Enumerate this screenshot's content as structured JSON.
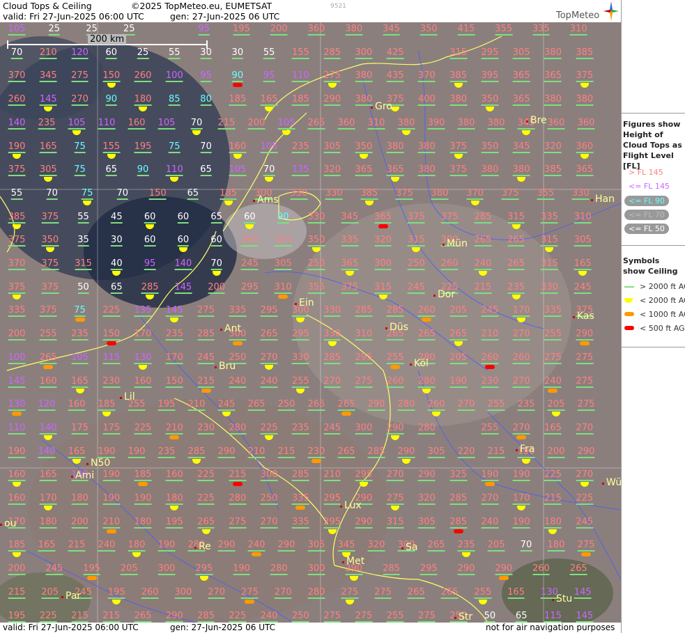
{
  "header": {
    "title": "Cloud Tops & Ceiling",
    "copyright": "©2025 TopMeteo.eu, EUMETSAT",
    "valid": "valid:  Fri  27-Jun-2025  06:00 UTC",
    "gen": "gen: 27-Jun-2025 06 UTC",
    "code": "9521",
    "logo": "TopMeteo"
  },
  "footer": {
    "valid": "valid:  Fri  27-Jun-2025  06:00 UTC",
    "gen": "gen: 27-Jun-2025 06 UTC",
    "disclaimer": "not for air navigation purposes"
  },
  "scale": {
    "label": "200 km"
  },
  "sidebar": {
    "figures_title": "Figures show Height of Cloud Tops as Flight Level  [FL]",
    "fl_legend": [
      "> FL 145",
      "<= FL 145",
      "<= FL 90",
      "<= FL 70",
      "<= FL 50"
    ],
    "symbols_title": "Symbols show Ceiling",
    "ceiling_legend": [
      "> 2000 ft AGL",
      "< 2000 ft AGL",
      "< 1000 ft AGL",
      "< 500 ft AGL"
    ],
    "colors": {
      "pink": "#ff8080",
      "violet": "#cc66ff",
      "cyan": "#66ffff",
      "grey": "#bbbbbb",
      "white": "#ffffff",
      "green": "#7ee07e",
      "yellow": "#ffff00",
      "orange": "#ff9900",
      "red": "#ff0000"
    }
  },
  "cities": [
    "Gro",
    "Bre",
    "Ams",
    "Han",
    "Mün",
    "Ein",
    "Dor",
    "Ant",
    "Düs",
    "Kas",
    "Bru",
    "Köl",
    "Lil",
    "Fra",
    "N50",
    "Ami",
    "Wü",
    "Lux",
    "Sa",
    "Re",
    "Met",
    "Par",
    "Stu",
    "Str",
    "ou"
  ],
  "grid_rows": [
    [
      "105",
      "25",
      "25",
      "25",
      "",
      "95",
      "195",
      "200",
      "360",
      "380",
      "345",
      "350",
      "415",
      "355",
      "335",
      "310"
    ],
    [
      "70",
      "210",
      "120",
      "60",
      "25",
      "55",
      "30",
      "30",
      "55",
      "155",
      "285",
      "300",
      "425",
      "",
      "315",
      "295",
      "305",
      "380",
      "385"
    ],
    [
      "370",
      "345",
      "275",
      "150",
      "260",
      "100",
      "95",
      "90",
      "95",
      "110",
      "275",
      "380",
      "435",
      "370",
      "385",
      "395",
      "365",
      "365",
      "375"
    ],
    [
      "260",
      "145",
      "270",
      "90",
      "180",
      "85",
      "80",
      "185",
      "165",
      "185",
      "290",
      "380",
      "375",
      "400",
      "380",
      "350",
      "365",
      "380",
      "380"
    ],
    [
      "140",
      "235",
      "105",
      "110",
      "160",
      "105",
      "70",
      "215",
      "200",
      "105",
      "265",
      "360",
      "310",
      "380",
      "390",
      "380",
      "380",
      "345",
      "360",
      "360"
    ],
    [
      "190",
      "165",
      "75",
      "155",
      "195",
      "75",
      "70",
      "160",
      "105",
      "235",
      "305",
      "350",
      "380",
      "380",
      "375",
      "350",
      "345",
      "320",
      "360"
    ],
    [
      "375",
      "305",
      "75",
      "65",
      "90",
      "110",
      "65",
      "105",
      "70",
      "135",
      "320",
      "365",
      "365",
      "380",
      "375",
      "380",
      "380",
      "385",
      "365"
    ],
    [
      "55",
      "70",
      "75",
      "70",
      "150",
      "65",
      "185",
      "300",
      "330",
      "330",
      "385",
      "375",
      "380",
      "370",
      "375",
      "355",
      "330"
    ],
    [
      "385",
      "375",
      "55",
      "45",
      "60",
      "60",
      "65",
      "60",
      "90",
      "330",
      "345",
      "365",
      "375",
      "375",
      "285",
      "315",
      "335",
      "310"
    ],
    [
      "375",
      "350",
      "35",
      "30",
      "60",
      "60",
      "60",
      "265",
      "325",
      "350",
      "335",
      "320",
      "315",
      "300",
      "265",
      "265",
      "315",
      "305"
    ],
    [
      "370",
      "375",
      "315",
      "40",
      "95",
      "140",
      "70",
      "245",
      "305",
      "250",
      "365",
      "300",
      "250",
      "260",
      "240",
      "265",
      "315",
      "165"
    ],
    [
      "375",
      "375",
      "50",
      "65",
      "285",
      "145",
      "200",
      "295",
      "310",
      "355",
      "375",
      "315",
      "245",
      "225",
      "215",
      "235",
      "330",
      "245"
    ],
    [
      "335",
      "375",
      "75",
      "225",
      "135",
      "145",
      "275",
      "335",
      "295",
      "300",
      "330",
      "285",
      "285",
      "260",
      "205",
      "245",
      "170",
      "335",
      "375"
    ],
    [
      "200",
      "255",
      "235",
      "150",
      "170",
      "235",
      "285",
      "300",
      "265",
      "295",
      "330",
      "310",
      "265",
      "265",
      "265",
      "210",
      "270",
      "255",
      "290"
    ],
    [
      "100",
      "265",
      "105",
      "115",
      "130",
      "170",
      "245",
      "250",
      "270",
      "330",
      "285",
      "295",
      "255",
      "280",
      "205",
      "260",
      "260",
      "275",
      "275"
    ],
    [
      "145",
      "160",
      "165",
      "230",
      "160",
      "150",
      "215",
      "240",
      "240",
      "255",
      "270",
      "275",
      "260",
      "280",
      "190",
      "230",
      "270",
      "240",
      "275"
    ],
    [
      "130",
      "120",
      "160",
      "185",
      "255",
      "195",
      "210",
      "245",
      "265",
      "250",
      "265",
      "265",
      "290",
      "280",
      "260",
      "270",
      "255",
      "235",
      "205",
      "275"
    ],
    [
      "110",
      "140",
      "175",
      "175",
      "225",
      "210",
      "230",
      "280",
      "225",
      "235",
      "245",
      "300",
      "290",
      "280",
      "",
      "255",
      "270",
      "165",
      "270"
    ],
    [
      "190",
      "140",
      "165",
      "190",
      "190",
      "235",
      "285",
      "290",
      "210",
      "215",
      "230",
      "265",
      "285",
      "290",
      "305",
      "220",
      "215",
      "190",
      "200",
      "290"
    ],
    [
      "160",
      "165",
      "130",
      "190",
      "185",
      "160",
      "225",
      "215",
      "300",
      "285",
      "210",
      "295",
      "270",
      "290",
      "325",
      "190",
      "190",
      "225",
      "270"
    ],
    [
      "160",
      "170",
      "180",
      "190",
      "190",
      "180",
      "225",
      "280",
      "250",
      "335",
      "295",
      "290",
      "275",
      "320",
      "285",
      "270",
      "170",
      "215",
      "225"
    ],
    [
      "170",
      "180",
      "200",
      "210",
      "180",
      "195",
      "265",
      "275",
      "270",
      "335",
      "295",
      "290",
      "315",
      "305",
      "285",
      "240",
      "190",
      "180",
      "245"
    ],
    [
      "185",
      "165",
      "215",
      "240",
      "180",
      "190",
      "280",
      "290",
      "240",
      "290",
      "305",
      "345",
      "320",
      "300",
      "265",
      "235",
      "205",
      "70",
      "180",
      "275"
    ],
    [
      "200",
      "245",
      "195",
      "205",
      "300",
      "295",
      "190",
      "280",
      "300",
      "290",
      "285",
      "295",
      "290",
      "290",
      "260",
      "265"
    ],
    [
      "215",
      "205",
      "245",
      "195",
      "260",
      "300",
      "270",
      "275",
      "270",
      "280",
      "275",
      "275",
      "265",
      "265",
      "255",
      "165",
      "130",
      "145"
    ],
    [
      "195",
      "225",
      "215",
      "215",
      "265",
      "290",
      "285",
      "225",
      "240",
      "250",
      "275",
      "275",
      "255",
      "275",
      "250",
      "50",
      "65",
      "115",
      "145"
    ]
  ]
}
